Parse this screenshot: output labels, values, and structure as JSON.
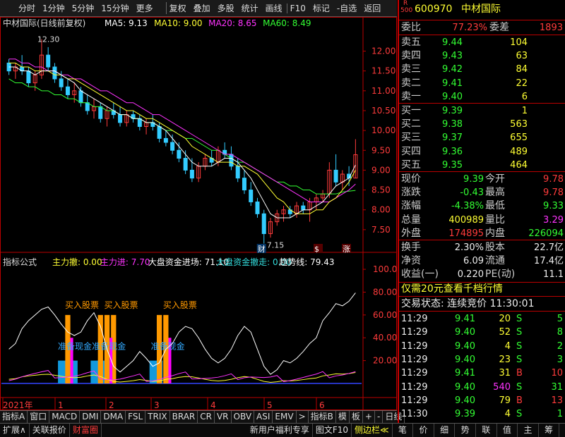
{
  "toolbar": {
    "items": [
      "分时",
      "1分钟",
      "5分钟",
      "15分钟",
      "更多",
      "复权",
      "叠加",
      "多股",
      "统计",
      "画线",
      "F10",
      "标记",
      "-自选",
      "返回"
    ]
  },
  "chart_header": {
    "title": "中材国际(日线前复权)",
    "ma": [
      {
        "label": "MA5: 9.13",
        "color": "#ffffff"
      },
      {
        "label": "MA10: 9.00",
        "color": "#ffff33"
      },
      {
        "label": "MA20: 8.65",
        "color": "#ff33ff"
      },
      {
        "label": "MA60: 8.49",
        "color": "#33ff33"
      }
    ]
  },
  "price_axis": {
    "ticks": [
      "12.00",
      "11.50",
      "11.00",
      "10.50",
      "10.00",
      "9.50",
      "9.00",
      "8.50",
      "8.00",
      "7.50"
    ],
    "high_label": "12.30",
    "low_label": "7.15",
    "markers": [
      "财",
      "$",
      "涨"
    ]
  },
  "indicator_header": {
    "title": "指标公式",
    "items": [
      {
        "label": "主力撤: 0.00",
        "color": "#ffff33"
      },
      {
        "label": "主力进: 7.70",
        "color": "#ff33ff"
      },
      {
        "label": "大盘资金进场: 71.10",
        "color": "#ffffff"
      },
      {
        "label": "大盘资金撤走: 0.00",
        "color": "#33dddd"
      },
      {
        "label": "趋势线: 79.43",
        "color": "#ffffff"
      }
    ],
    "annotations": [
      "买入股票",
      "买入股票",
      "买入股票",
      "准备现金",
      "准备现金",
      "准备现金"
    ]
  },
  "indicator_axis": {
    "ticks": [
      "100.00",
      "80.00",
      "60.00",
      "40.00",
      "20.00"
    ]
  },
  "chart_data": {
    "type": "line",
    "candles": [
      [
        11.7,
        11.8,
        11.4,
        11.5
      ],
      [
        11.5,
        11.7,
        11.3,
        11.6
      ],
      [
        11.6,
        11.9,
        11.4,
        11.5
      ],
      [
        11.5,
        11.6,
        11.1,
        11.2
      ],
      [
        11.2,
        11.5,
        11.0,
        11.4
      ],
      [
        11.4,
        12.3,
        11.3,
        11.9
      ],
      [
        11.9,
        12.1,
        11.5,
        11.6
      ],
      [
        11.6,
        11.7,
        11.2,
        11.3
      ],
      [
        11.3,
        11.5,
        11.0,
        11.1
      ],
      [
        11.1,
        11.3,
        10.8,
        10.9
      ],
      [
        10.9,
        11.2,
        10.7,
        11.0
      ],
      [
        11.0,
        11.1,
        10.6,
        10.7
      ],
      [
        10.7,
        10.9,
        10.4,
        10.5
      ],
      [
        10.5,
        10.8,
        10.3,
        10.6
      ],
      [
        10.6,
        10.7,
        10.2,
        10.3
      ],
      [
        10.3,
        10.6,
        10.1,
        10.5
      ],
      [
        10.5,
        10.7,
        10.3,
        10.4
      ],
      [
        10.4,
        10.6,
        10.1,
        10.2
      ],
      [
        10.2,
        10.5,
        10.1,
        10.4
      ],
      [
        10.4,
        10.5,
        10.2,
        10.3
      ],
      [
        10.3,
        10.4,
        10.0,
        10.1
      ],
      [
        10.1,
        10.3,
        9.9,
        10.2
      ],
      [
        10.2,
        10.4,
        10.0,
        10.1
      ],
      [
        10.1,
        10.2,
        9.7,
        9.8
      ],
      [
        9.8,
        10.0,
        9.6,
        9.7
      ],
      [
        9.7,
        9.9,
        9.4,
        9.5
      ],
      [
        9.5,
        9.7,
        9.2,
        9.3
      ],
      [
        9.3,
        9.5,
        8.9,
        9.0
      ],
      [
        9.0,
        9.3,
        8.7,
        8.8
      ],
      [
        8.8,
        9.2,
        8.7,
        9.1
      ],
      [
        9.1,
        9.4,
        9.0,
        9.3
      ],
      [
        9.3,
        9.5,
        9.1,
        9.2
      ],
      [
        9.2,
        9.6,
        9.1,
        9.5
      ],
      [
        9.5,
        9.7,
        9.3,
        9.4
      ],
      [
        9.4,
        9.6,
        9.0,
        9.1
      ],
      [
        9.1,
        9.3,
        8.7,
        8.8
      ],
      [
        8.8,
        9.0,
        8.4,
        8.5
      ],
      [
        8.5,
        8.7,
        8.1,
        8.2
      ],
      [
        8.2,
        8.3,
        7.8,
        7.9
      ],
      [
        7.9,
        8.0,
        7.15,
        7.4
      ],
      [
        7.4,
        7.8,
        7.3,
        7.7
      ],
      [
        7.7,
        8.0,
        7.6,
        7.9
      ],
      [
        7.9,
        8.1,
        7.7,
        8.0
      ],
      [
        8.0,
        8.1,
        7.8,
        7.9
      ],
      [
        7.9,
        8.2,
        7.8,
        8.1
      ],
      [
        8.1,
        8.2,
        7.9,
        8.0
      ],
      [
        8.0,
        8.3,
        7.7,
        8.2
      ],
      [
        8.2,
        8.4,
        8.0,
        8.3
      ],
      [
        8.3,
        8.5,
        8.2,
        8.4
      ],
      [
        8.4,
        9.2,
        8.3,
        9.0
      ],
      [
        9.0,
        9.4,
        8.6,
        8.7
      ],
      [
        8.7,
        9.0,
        8.5,
        8.9
      ],
      [
        8.9,
        9.1,
        8.6,
        8.8
      ],
      [
        8.8,
        9.78,
        8.8,
        9.39
      ]
    ],
    "price_range": [
      7.0,
      12.4
    ],
    "ma5": [
      11.6,
      11.6,
      11.5,
      11.5,
      11.4,
      11.5,
      11.5,
      11.5,
      11.4,
      11.3,
      11.2,
      11.0,
      10.9,
      10.8,
      10.7,
      10.6,
      10.5,
      10.4,
      10.4,
      10.3,
      10.3,
      10.2,
      10.2,
      10.1,
      10.0,
      9.8,
      9.6,
      9.4,
      9.2,
      9.1,
      9.1,
      9.1,
      9.2,
      9.3,
      9.3,
      9.2,
      9.0,
      8.8,
      8.5,
      8.2,
      7.9,
      7.8,
      7.8,
      7.8,
      7.9,
      8.0,
      8.0,
      8.1,
      8.2,
      8.4,
      8.6,
      8.7,
      8.8,
      9.13
    ],
    "ma10": [
      11.7,
      11.7,
      11.6,
      11.6,
      11.5,
      11.5,
      11.5,
      11.4,
      11.4,
      11.3,
      11.3,
      11.2,
      11.1,
      11.0,
      10.9,
      10.8,
      10.7,
      10.6,
      10.5,
      10.5,
      10.4,
      10.3,
      10.3,
      10.2,
      10.1,
      10.0,
      9.9,
      9.8,
      9.6,
      9.5,
      9.4,
      9.3,
      9.2,
      9.2,
      9.2,
      9.1,
      9.1,
      9.0,
      8.9,
      8.7,
      8.5,
      8.3,
      8.2,
      8.0,
      7.9,
      7.9,
      7.9,
      8.0,
      8.0,
      8.2,
      8.3,
      8.5,
      8.7,
      9.0
    ],
    "ma20": [
      11.8,
      11.8,
      11.7,
      11.7,
      11.6,
      11.6,
      11.5,
      11.5,
      11.4,
      11.4,
      11.3,
      11.3,
      11.2,
      11.1,
      11.0,
      11.0,
      10.9,
      10.8,
      10.7,
      10.7,
      10.6,
      10.5,
      10.4,
      10.4,
      10.3,
      10.2,
      10.1,
      10.0,
      9.9,
      9.8,
      9.7,
      9.6,
      9.5,
      9.4,
      9.4,
      9.3,
      9.2,
      9.1,
      9.0,
      8.9,
      8.8,
      8.7,
      8.6,
      8.5,
      8.4,
      8.3,
      8.2,
      8.2,
      8.2,
      8.2,
      8.3,
      8.4,
      8.5,
      8.65
    ],
    "ma60": [
      11.3,
      11.2,
      11.2,
      11.1,
      11.1,
      11.0,
      11.0,
      10.9,
      10.9,
      10.8,
      10.8,
      10.7,
      10.7,
      10.6,
      10.6,
      10.5,
      10.5,
      10.4,
      10.4,
      10.3,
      10.3,
      10.2,
      10.2,
      10.1,
      10.0,
      10.0,
      9.9,
      9.8,
      9.8,
      9.7,
      9.6,
      9.5,
      9.5,
      9.4,
      9.3,
      9.2,
      9.2,
      9.1,
      9.0,
      8.9,
      8.8,
      8.7,
      8.7,
      8.6,
      8.6,
      8.5,
      8.5,
      8.4,
      8.4,
      8.4,
      8.4,
      8.45,
      8.47,
      8.49
    ],
    "trend_line": [
      30,
      35,
      48,
      55,
      60,
      65,
      67,
      60,
      52,
      45,
      42,
      45,
      55,
      62,
      50,
      30,
      15,
      10,
      15,
      20,
      28,
      22,
      15,
      18,
      30,
      35,
      45,
      50,
      48,
      40,
      30,
      22,
      18,
      22,
      30,
      42,
      50,
      45,
      30,
      15,
      8,
      12,
      20,
      18,
      22,
      28,
      35,
      40,
      55,
      62,
      70,
      68,
      72,
      79.43
    ],
    "indicator_range": [
      0,
      105
    ],
    "cyan_bars": [
      [
        8,
        10,
        20
      ],
      [
        13,
        15,
        20
      ],
      [
        22,
        23,
        20
      ]
    ],
    "orange_bars": [
      [
        9,
        60
      ],
      [
        14,
        60
      ],
      [
        15,
        60
      ],
      [
        16,
        60
      ],
      [
        23,
        60
      ],
      [
        24,
        60
      ]
    ],
    "magenta_bars": [
      [
        9,
        40
      ],
      [
        15,
        40
      ],
      [
        24,
        40
      ]
    ],
    "x_labels": [
      "2021年",
      "1",
      "2",
      "3",
      "4",
      "5",
      "6"
    ]
  },
  "bottombar": {
    "tabs": [
      "指标A",
      "窗口",
      "MACD",
      "DMI",
      "DMA",
      "FSL",
      "TRIX",
      "BRAR",
      "CR",
      "VR",
      "OBV",
      "ASI",
      "EMV",
      ">",
      "指标B",
      "模",
      "板",
      "+",
      "-",
      "日线"
    ]
  },
  "statusbar": {
    "left": [
      {
        "label": "扩展∧",
        "color": "#dddddd"
      },
      {
        "label": "关联报价",
        "color": "#dddddd"
      },
      {
        "label": "财富圈",
        "color": "#ff3b3b"
      }
    ],
    "middle": [
      {
        "label": "新用户福利专享",
        "color": "#dddddd"
      },
      {
        "label": "图文F10",
        "color": "#dddddd"
      },
      {
        "label": "侧边栏≪",
        "color": "#ffff33"
      }
    ],
    "right": [
      "笔",
      "价",
      "细",
      "势",
      "联",
      "值",
      "主",
      "筹"
    ]
  },
  "quote": {
    "code": "600970",
    "name": "中材国际",
    "badge_top": "R",
    "badge_bottom": "500",
    "weibi_label": "委比",
    "weibi": "77.23%",
    "weicha_label": "委差",
    "weicha": "1893",
    "asks": [
      {
        "label": "卖五",
        "price": "9.44",
        "vol": "104"
      },
      {
        "label": "卖四",
        "price": "9.43",
        "vol": "63"
      },
      {
        "label": "卖三",
        "price": "9.42",
        "vol": "84"
      },
      {
        "label": "卖二",
        "price": "9.41",
        "vol": "22"
      },
      {
        "label": "卖一",
        "price": "9.40",
        "vol": "6"
      }
    ],
    "bids": [
      {
        "label": "买一",
        "price": "9.39",
        "vol": "1"
      },
      {
        "label": "买二",
        "price": "9.38",
        "vol": "563"
      },
      {
        "label": "买三",
        "price": "9.37",
        "vol": "655"
      },
      {
        "label": "买四",
        "price": "9.36",
        "vol": "489"
      },
      {
        "label": "买五",
        "price": "9.35",
        "vol": "464"
      }
    ],
    "stats": [
      {
        "l1": "现价",
        "v1": "9.39",
        "c1": "green",
        "l2": "今开",
        "v2": "9.78",
        "c2": "red"
      },
      {
        "l1": "涨跌",
        "v1": "-0.43",
        "c1": "green",
        "l2": "最高",
        "v2": "9.78",
        "c2": "red"
      },
      {
        "l1": "涨幅",
        "v1": "-4.38%",
        "c1": "green",
        "l2": "最低",
        "v2": "9.33",
        "c2": "green"
      },
      {
        "l1": "总量",
        "v1": "400989",
        "c1": "yellow",
        "l2": "量比",
        "v2": "3.29",
        "c2": "magenta"
      },
      {
        "l1": "外盘",
        "v1": "174895",
        "c1": "red",
        "l2": "内盘",
        "v2": "226094",
        "c2": "green"
      }
    ],
    "stats2": [
      {
        "l1": "换手",
        "v1": "2.30%",
        "l2": "股本",
        "v2": "22.7亿"
      },
      {
        "l1": "净资",
        "v1": "6.09",
        "l2": "流通",
        "v2": "17.4亿"
      },
      {
        "l1": "收益(一)",
        "v1": "0.220",
        "l2": "PE(动)",
        "v2": "11.1"
      }
    ],
    "promo": "仅需20元查看千档行情",
    "trade_status": "交易状态: 连续竞价 11:30:01",
    "ticks": [
      {
        "time": "11:29",
        "price": "9.41",
        "pc": "green",
        "vol": "20",
        "vc": "yellow",
        "side": "S",
        "sc": "green",
        "n": "5"
      },
      {
        "time": "11:29",
        "price": "9.40",
        "pc": "green",
        "vol": "52",
        "vc": "yellow",
        "side": "S",
        "sc": "green",
        "n": "8"
      },
      {
        "time": "11:29",
        "price": "9.40",
        "pc": "green",
        "vol": "4",
        "vc": "yellow",
        "side": "S",
        "sc": "green",
        "n": "2"
      },
      {
        "time": "11:29",
        "price": "9.40",
        "pc": "green",
        "vol": "23",
        "vc": "yellow",
        "side": "S",
        "sc": "green",
        "n": "3"
      },
      {
        "time": "11:29",
        "price": "9.41",
        "pc": "green",
        "vol": "31",
        "vc": "yellow",
        "side": "B",
        "sc": "red",
        "n": "10"
      },
      {
        "time": "11:29",
        "price": "9.40",
        "pc": "green",
        "vol": "540",
        "vc": "magenta",
        "side": "S",
        "sc": "green",
        "n": "31"
      },
      {
        "time": "11:29",
        "price": "9.40",
        "pc": "green",
        "vol": "79",
        "vc": "yellow",
        "side": "B",
        "sc": "red",
        "n": "13"
      },
      {
        "time": "11:30",
        "price": "9.39",
        "pc": "green",
        "vol": "4",
        "vc": "yellow",
        "side": "S",
        "sc": "green",
        "n": "1"
      }
    ]
  }
}
